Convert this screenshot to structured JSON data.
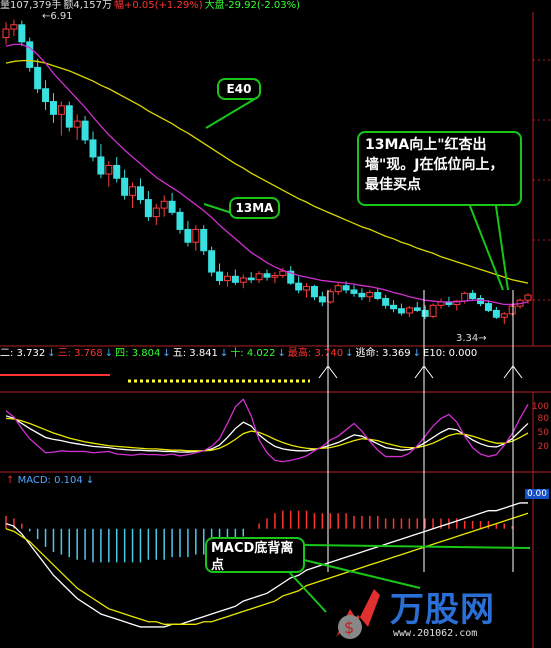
{
  "header": {
    "parts": [
      {
        "text": "量107,379手",
        "color": "#dddddd"
      },
      {
        "text": "额4,157万",
        "color": "#dddddd"
      },
      {
        "text": "幅+0.05(+1.29%)",
        "color": "#ff3333"
      },
      {
        "text": "大盘-29.92(-2.03%)",
        "color": "#33ff33"
      }
    ]
  },
  "price_labels": {
    "high": "6.91",
    "low": "3.34"
  },
  "ma_row": [
    {
      "text": "二: 3.732",
      "color": "#ffffff",
      "arrow": "↓"
    },
    {
      "text": "三: 3.768",
      "color": "#ff3333",
      "arrow": "↓"
    },
    {
      "text": "四: 3.804",
      "color": "#33ff33",
      "arrow": "↓"
    },
    {
      "text": "五: 3.841",
      "color": "#ffffff",
      "arrow": "↓"
    },
    {
      "text": "十: 4.022",
      "color": "#33ff33",
      "arrow": "↓"
    },
    {
      "text": "最高: 3.740",
      "color": "#ff3333",
      "arrow": "↓"
    },
    {
      "text": "逃命: 3.369",
      "color": "#ffffff",
      "arrow": "↓"
    },
    {
      "text": "E10: 0.000",
      "color": "#ffffff",
      "arrow": ""
    }
  ],
  "kdj_axis": [
    "100",
    "80",
    "50",
    "20"
  ],
  "macd": {
    "label": "MACD: 0.104",
    "arrow": "↓",
    "right_value": "0.00"
  },
  "callouts": {
    "e40": "E40",
    "ma13": "13MA",
    "buy_point": "13MA向上\"红杏出墙\"现。J在低位向上，最佳买点",
    "macd_div": "MACD底背离点"
  },
  "watermark": {
    "text": "万股网",
    "url": "www.201062.com"
  },
  "colors": {
    "up": "#ff3b3b",
    "down": "#38e0e0",
    "ma13": "#d030d0",
    "e40": "#d8d800",
    "callout_border": "#19c519",
    "vline": "#ffffff",
    "macd_pos": "#ff3333",
    "macd_neg": "#4fc8e8"
  },
  "chart_data": [
    {
      "type": "candlestick",
      "title": "",
      "ohlc": [
        [
          6.7,
          6.88,
          6.62,
          6.8
        ],
        [
          6.8,
          6.91,
          6.72,
          6.85
        ],
        [
          6.85,
          6.9,
          6.6,
          6.65
        ],
        [
          6.65,
          6.7,
          6.3,
          6.35
        ],
        [
          6.35,
          6.45,
          6.05,
          6.1
        ],
        [
          6.1,
          6.2,
          5.85,
          5.95
        ],
        [
          5.95,
          6.05,
          5.7,
          5.8
        ],
        [
          5.8,
          5.95,
          5.55,
          5.9
        ],
        [
          5.9,
          5.95,
          5.6,
          5.65
        ],
        [
          5.65,
          5.8,
          5.5,
          5.72
        ],
        [
          5.72,
          5.78,
          5.45,
          5.5
        ],
        [
          5.5,
          5.6,
          5.25,
          5.3
        ],
        [
          5.3,
          5.45,
          5.05,
          5.1
        ],
        [
          5.1,
          5.25,
          4.95,
          5.2
        ],
        [
          5.2,
          5.3,
          5.0,
          5.05
        ],
        [
          5.05,
          5.15,
          4.8,
          4.85
        ],
        [
          4.85,
          5.0,
          4.7,
          4.95
        ],
        [
          4.95,
          5.05,
          4.75,
          4.8
        ],
        [
          4.8,
          4.9,
          4.55,
          4.6
        ],
        [
          4.6,
          4.75,
          4.5,
          4.7
        ],
        [
          4.7,
          4.85,
          4.6,
          4.78
        ],
        [
          4.78,
          4.88,
          4.62,
          4.65
        ],
        [
          4.65,
          4.7,
          4.4,
          4.45
        ],
        [
          4.45,
          4.55,
          4.25,
          4.3
        ],
        [
          4.3,
          4.5,
          4.2,
          4.45
        ],
        [
          4.45,
          4.5,
          4.15,
          4.2
        ],
        [
          4.2,
          4.25,
          3.9,
          3.95
        ],
        [
          3.95,
          4.05,
          3.8,
          3.85
        ],
        [
          3.85,
          3.95,
          3.78,
          3.9
        ],
        [
          3.9,
          3.98,
          3.8,
          3.83
        ],
        [
          3.83,
          3.92,
          3.76,
          3.88
        ],
        [
          3.88,
          3.95,
          3.82,
          3.86
        ],
        [
          3.86,
          3.96,
          3.82,
          3.93
        ],
        [
          3.93,
          3.98,
          3.85,
          3.89
        ],
        [
          3.89,
          3.95,
          3.82,
          3.91
        ],
        [
          3.91,
          4.0,
          3.88,
          3.96
        ],
        [
          3.96,
          4.02,
          3.8,
          3.82
        ],
        [
          3.82,
          3.9,
          3.7,
          3.74
        ],
        [
          3.74,
          3.82,
          3.65,
          3.78
        ],
        [
          3.78,
          3.8,
          3.62,
          3.66
        ],
        [
          3.66,
          3.72,
          3.55,
          3.6
        ],
        [
          3.6,
          3.75,
          3.58,
          3.72
        ],
        [
          3.72,
          3.82,
          3.68,
          3.79
        ],
        [
          3.79,
          3.84,
          3.7,
          3.74
        ],
        [
          3.74,
          3.8,
          3.66,
          3.7
        ],
        [
          3.7,
          3.76,
          3.62,
          3.66
        ],
        [
          3.66,
          3.74,
          3.6,
          3.71
        ],
        [
          3.71,
          3.76,
          3.62,
          3.64
        ],
        [
          3.64,
          3.68,
          3.52,
          3.56
        ],
        [
          3.56,
          3.62,
          3.48,
          3.52
        ],
        [
          3.52,
          3.58,
          3.44,
          3.47
        ],
        [
          3.47,
          3.55,
          3.42,
          3.53
        ],
        [
          3.53,
          3.6,
          3.48,
          3.5
        ],
        [
          3.5,
          3.56,
          3.4,
          3.43
        ],
        [
          3.43,
          3.58,
          3.41,
          3.56
        ],
        [
          3.56,
          3.64,
          3.52,
          3.6
        ],
        [
          3.6,
          3.66,
          3.54,
          3.57
        ],
        [
          3.57,
          3.62,
          3.5,
          3.61
        ],
        [
          3.61,
          3.72,
          3.58,
          3.7
        ],
        [
          3.7,
          3.74,
          3.62,
          3.64
        ],
        [
          3.64,
          3.68,
          3.55,
          3.58
        ],
        [
          3.58,
          3.62,
          3.48,
          3.5
        ],
        [
          3.5,
          3.54,
          3.4,
          3.42
        ],
        [
          3.42,
          3.48,
          3.34,
          3.46
        ],
        [
          3.46,
          3.58,
          3.44,
          3.55
        ],
        [
          3.55,
          3.64,
          3.52,
          3.62
        ],
        [
          3.62,
          3.7,
          3.58,
          3.68
        ]
      ],
      "ma13": [
        6.6,
        6.62,
        6.62,
        6.58,
        6.5,
        6.4,
        6.28,
        6.18,
        6.08,
        5.98,
        5.88,
        5.77,
        5.66,
        5.56,
        5.47,
        5.38,
        5.3,
        5.22,
        5.14,
        5.06,
        5.0,
        4.94,
        4.88,
        4.81,
        4.74,
        4.67,
        4.59,
        4.5,
        4.42,
        4.34,
        4.26,
        4.18,
        4.12,
        4.06,
        4.01,
        3.97,
        3.94,
        3.91,
        3.89,
        3.87,
        3.85,
        3.84,
        3.83,
        3.82,
        3.81,
        3.79,
        3.78,
        3.76,
        3.74,
        3.71,
        3.69,
        3.66,
        3.64,
        3.62,
        3.61,
        3.6,
        3.6,
        3.6,
        3.61,
        3.62,
        3.62,
        3.61,
        3.59,
        3.57,
        3.57,
        3.58,
        3.6
      ],
      "e40": [
        6.4,
        6.42,
        6.43,
        6.43,
        6.42,
        6.4,
        6.37,
        6.34,
        6.31,
        6.27,
        6.23,
        6.19,
        6.14,
        6.1,
        6.05,
        6.0,
        5.95,
        5.9,
        5.84,
        5.79,
        5.74,
        5.69,
        5.63,
        5.58,
        5.52,
        5.46,
        5.4,
        5.34,
        5.28,
        5.22,
        5.17,
        5.11,
        5.06,
        5.01,
        4.96,
        4.91,
        4.86,
        4.81,
        4.77,
        4.72,
        4.68,
        4.64,
        4.6,
        4.56,
        4.52,
        4.48,
        4.45,
        4.41,
        4.37,
        4.34,
        4.3,
        4.27,
        4.23,
        4.2,
        4.17,
        4.13,
        4.1,
        4.07,
        4.04,
        4.01,
        3.98,
        3.95,
        3.92,
        3.89,
        3.86,
        3.84,
        3.82
      ],
      "ylim": [
        3.2,
        7.0
      ]
    },
    {
      "type": "line",
      "title": "KDJ",
      "series": [
        {
          "name": "K",
          "values": [
            82,
            78,
            70,
            62,
            55,
            48,
            45,
            43,
            40,
            38,
            36,
            34,
            33,
            32,
            30,
            29,
            28,
            28,
            27,
            27,
            26,
            26,
            25,
            25,
            26,
            27,
            30,
            36,
            48,
            62,
            72,
            66,
            52,
            42,
            34,
            30,
            28,
            27,
            27,
            29,
            32,
            36,
            40,
            46,
            52,
            50,
            44,
            38,
            32,
            30,
            28,
            29,
            33,
            40,
            48,
            56,
            62,
            60,
            52,
            44,
            38,
            34,
            33,
            38,
            46,
            58,
            70
          ]
        },
        {
          "name": "D",
          "values": [
            78,
            77,
            74,
            70,
            65,
            60,
            55,
            51,
            47,
            44,
            41,
            39,
            37,
            35,
            34,
            33,
            32,
            31,
            30,
            30,
            29,
            28,
            28,
            27,
            27,
            27,
            28,
            31,
            37,
            45,
            54,
            58,
            56,
            51,
            45,
            40,
            36,
            33,
            31,
            30,
            31,
            32,
            35,
            39,
            43,
            46,
            45,
            43,
            39,
            36,
            33,
            32,
            32,
            35,
            39,
            45,
            51,
            54,
            53,
            50,
            46,
            42,
            39,
            39,
            42,
            48,
            55
          ]
        },
        {
          "name": "J",
          "values": [
            90,
            80,
            62,
            46,
            35,
            24,
            25,
            27,
            26,
            26,
            26,
            24,
            25,
            26,
            22,
            21,
            20,
            22,
            21,
            21,
            20,
            22,
            19,
            21,
            24,
            27,
            34,
            46,
            70,
            96,
            108,
            82,
            44,
            24,
            12,
            10,
            12,
            15,
            19,
            27,
            34,
            44,
            50,
            60,
            70,
            58,
            42,
            28,
            18,
            18,
            18,
            23,
            35,
            50,
            66,
            78,
            84,
            72,
            50,
            32,
            22,
            18,
            21,
            36,
            54,
            78,
            100
          ]
        }
      ],
      "ylim": [
        0,
        110
      ]
    },
    {
      "type": "bar",
      "title": "MACD",
      "values": [
        0.05,
        0.04,
        0.02,
        -0.01,
        -0.04,
        -0.07,
        -0.09,
        -0.1,
        -0.11,
        -0.12,
        -0.12,
        -0.13,
        -0.13,
        -0.13,
        -0.13,
        -0.13,
        -0.13,
        -0.13,
        -0.12,
        -0.12,
        -0.12,
        -0.11,
        -0.11,
        -0.11,
        -0.1,
        -0.1,
        -0.1,
        -0.09,
        -0.08,
        -0.06,
        -0.03,
        0.0,
        0.02,
        0.04,
        0.06,
        0.07,
        0.07,
        0.07,
        0.07,
        0.06,
        0.06,
        0.06,
        0.06,
        0.06,
        0.05,
        0.05,
        0.05,
        0.05,
        0.04,
        0.04,
        0.04,
        0.04,
        0.04,
        0.04,
        0.04,
        0.04,
        0.04,
        0.04,
        0.03,
        0.03,
        0.03,
        0.03,
        0.02,
        0.02,
        0.01,
        0.0,
        0.0
      ],
      "series": [
        {
          "name": "DIF",
          "values": [
            0.02,
            0.01,
            -0.02,
            -0.06,
            -0.1,
            -0.14,
            -0.18,
            -0.21,
            -0.24,
            -0.27,
            -0.29,
            -0.31,
            -0.33,
            -0.34,
            -0.35,
            -0.36,
            -0.37,
            -0.38,
            -0.38,
            -0.38,
            -0.38,
            -0.37,
            -0.37,
            -0.36,
            -0.35,
            -0.34,
            -0.33,
            -0.32,
            -0.31,
            -0.3,
            -0.28,
            -0.27,
            -0.26,
            -0.25,
            -0.23,
            -0.21,
            -0.19,
            -0.18,
            -0.16,
            -0.15,
            -0.14,
            -0.13,
            -0.12,
            -0.11,
            -0.1,
            -0.09,
            -0.08,
            -0.07,
            -0.06,
            -0.05,
            -0.04,
            -0.03,
            -0.02,
            -0.01,
            0.0,
            0.01,
            0.02,
            0.03,
            0.04,
            0.05,
            0.06,
            0.07,
            0.07,
            0.08,
            0.09,
            0.1,
            0.1
          ]
        },
        {
          "name": "DEA",
          "values": [
            0.0,
            -0.01,
            -0.03,
            -0.05,
            -0.08,
            -0.11,
            -0.14,
            -0.17,
            -0.2,
            -0.23,
            -0.25,
            -0.27,
            -0.29,
            -0.31,
            -0.32,
            -0.33,
            -0.34,
            -0.35,
            -0.36,
            -0.36,
            -0.37,
            -0.37,
            -0.37,
            -0.37,
            -0.37,
            -0.36,
            -0.36,
            -0.35,
            -0.34,
            -0.33,
            -0.32,
            -0.31,
            -0.3,
            -0.29,
            -0.28,
            -0.26,
            -0.25,
            -0.24,
            -0.22,
            -0.21,
            -0.2,
            -0.19,
            -0.18,
            -0.17,
            -0.16,
            -0.15,
            -0.14,
            -0.13,
            -0.12,
            -0.11,
            -0.1,
            -0.09,
            -0.08,
            -0.07,
            -0.06,
            -0.05,
            -0.04,
            -0.03,
            -0.02,
            -0.01,
            0.0,
            0.01,
            0.02,
            0.03,
            0.04,
            0.05,
            0.06
          ]
        }
      ],
      "ylim": [
        -0.45,
        0.15
      ]
    }
  ]
}
